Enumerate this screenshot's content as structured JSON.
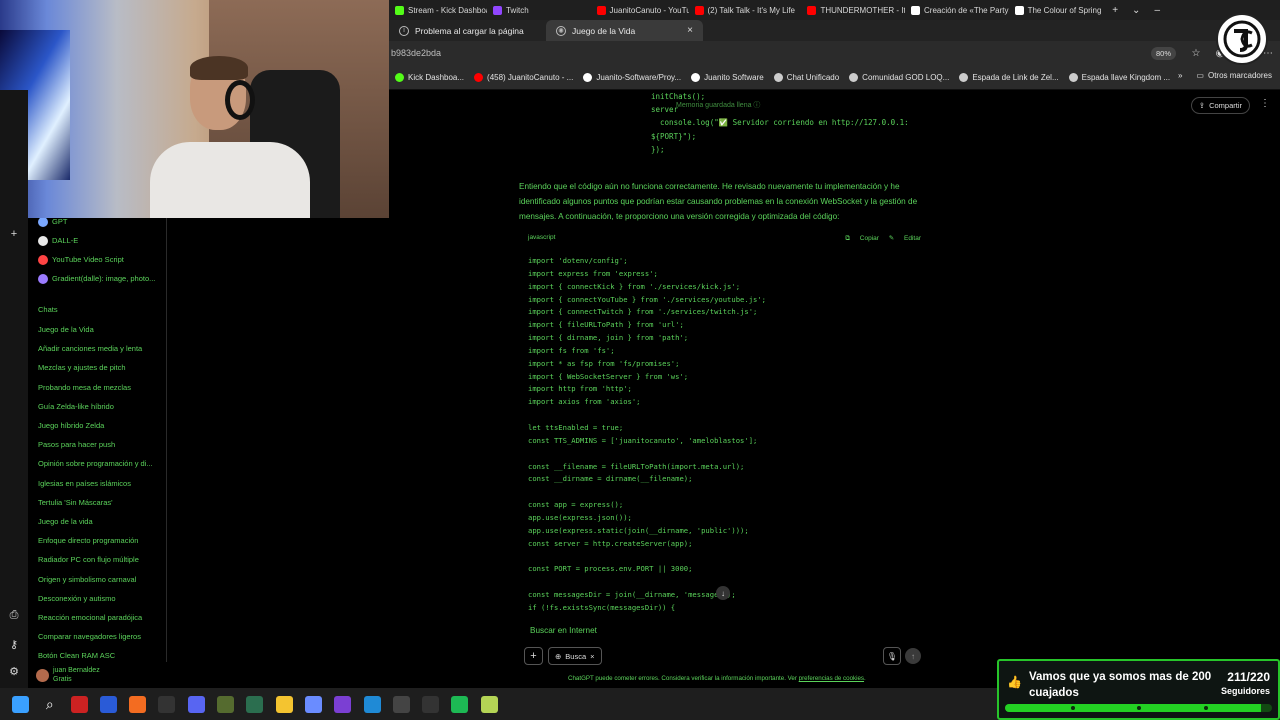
{
  "browser": {
    "tabs": [
      {
        "label": "Stream - Kick Dashboard",
        "color": "#53fc18"
      },
      {
        "label": "Twitch",
        "color": "#9146ff"
      },
      {
        "label": "JuanitoCanuto - YouTube",
        "color": "#ff0000"
      },
      {
        "label": "(2) Talk Talk - It's My Life",
        "color": "#ff0000"
      },
      {
        "label": "THUNDERMOTHER - It",
        "color": "#ff0000"
      },
      {
        "label": "Creación de «The Party»",
        "color": "#ffffff"
      },
      {
        "label": "The Colour of Spring",
        "color": "#ffffff"
      }
    ],
    "row2_tabs": [
      {
        "label": "Problema al cargar la página"
      },
      {
        "label": "Juego de la Vida"
      }
    ],
    "url": "b983de2bda",
    "zoom": "80%",
    "bookmarks": [
      {
        "label": "Kick Dashboa...",
        "color": "#53fc18"
      },
      {
        "label": "(458) JuanitoCanuto - ...",
        "color": "#ff0000"
      },
      {
        "label": "Juanito-Software/Proy...",
        "color": "#ffffff"
      },
      {
        "label": "Juanito Software",
        "color": "#ffffff"
      },
      {
        "label": "Chat Unificado",
        "color": "#cccccc"
      },
      {
        "label": "Comunidad GOD LOQ...",
        "color": "#cccccc"
      },
      {
        "label": "Espada de Link de Zel...",
        "color": "#cccccc"
      },
      {
        "label": "Espada llave Kingdom ...",
        "color": "#cccccc"
      }
    ],
    "other_bookmarks": "Otros marcadores"
  },
  "sidebar": {
    "gpts": [
      {
        "label": "GPT",
        "color": "#7aa7ff"
      },
      {
        "label": "DALL-E",
        "color": "#e8e8e8"
      },
      {
        "label": "YouTube Video Script",
        "color": "#ff4444"
      },
      {
        "label": "Gradient(dalle): image, photo...",
        "color": "#9b7bff"
      }
    ],
    "chats_heading": "Chats",
    "chats": [
      "Juego de la Vida",
      "Añadir canciones media y lenta",
      "Mezclas y ajustes de pitch",
      "Probando mesa de mezclas",
      "Guía Zelda-like híbrido",
      "Juego híbrido Zelda",
      "Pasos para hacer push",
      "Opinión sobre programación y di...",
      "Iglesias en países islámicos",
      "Tertulia 'Sin Máscaras'",
      "Juego de la vida",
      "Enfoque directo programación",
      "Radiador PC con flujo múltiple",
      "Origen y simbolismo carnaval",
      "Desconexión y autismo",
      "Reacción emocional paradójica",
      "Comparar navegadores ligeros",
      "Botón Clean RAM ASC"
    ],
    "user": {
      "name": "juan Bernaldez",
      "plan": "Gratis"
    }
  },
  "main": {
    "code_top": "initChats();\nserver\n  console.log(\"✅ Servidor corriendo en http://127.0.0.1:\n${PORT}\");\n});",
    "memory_note": "Memoria guardada llena ⓘ",
    "share_label": "Compartir",
    "paragraph": "Entiendo que el código aún no funciona correctamente. He revisado nuevamente tu implementación y he identificado algunos puntos que podrían estar causando problemas en la conexión WebSocket y la gestión de mensajes. A continuación, te proporciono una versión corregida y optimizada del código:",
    "code_lang": "javascript",
    "copy_label": "Copiar",
    "edit_label": "Editar",
    "code": "import 'dotenv/config';\nimport express from 'express';\nimport { connectKick } from './services/kick.js';\nimport { connectYouTube } from './services/youtube.js';\nimport { connectTwitch } from './services/twitch.js';\nimport { fileURLToPath } from 'url';\nimport { dirname, join } from 'path';\nimport fs from 'fs';\nimport * as fsp from 'fs/promises';\nimport { WebSocketServer } from 'ws';\nimport http from 'http';\nimport axios from 'axios';\n\nlet ttsEnabled = true;\nconst TTS_ADMINS = ['juanitocanuto', 'ameloblastos'];\n\nconst __filename = fileURLToPath(import.meta.url);\nconst __dirname = dirname(__filename);\n\nconst app = express();\napp.use(express.json());\napp.use(express.static(join(__dirname, 'public')));\nconst server = http.createServer(app);\n\nconst PORT = process.env.PORT || 3000;\n\nconst messagesDir = join(__dirname, 'messages');\nif (!fs.existsSync(messagesDir)) {",
    "search_web": "Buscar en Internet",
    "search_chip": "Busca",
    "disclaimer": "ChatGPT puede cometer errores. Considera verificar la información importante. Ver",
    "disclaimer_link": "preferencias de cookies",
    "disclaimer_end": "."
  },
  "widget": {
    "text": "Vamos que ya somos mas de 200 cuajados",
    "count": "211/220",
    "label": "Seguidores",
    "progress_fraction": 0.959
  },
  "taskbar": {
    "icons": [
      {
        "name": "windows-start-icon",
        "color": "#3aa0ff"
      },
      {
        "name": "search-icon",
        "color": "#1e1e1e"
      },
      {
        "name": "app-icon",
        "color": "#c22"
      },
      {
        "name": "app-icon",
        "color": "#2a5bd7"
      },
      {
        "name": "brave-icon",
        "color": "#f36c21"
      },
      {
        "name": "app-icon",
        "color": "#333"
      },
      {
        "name": "discord-icon",
        "color": "#5865f2"
      },
      {
        "name": "app-icon",
        "color": "#556b2f"
      },
      {
        "name": "chatgpt-icon",
        "color": "#2b6e4f"
      },
      {
        "name": "folder-icon",
        "color": "#f4c430"
      },
      {
        "name": "app-icon",
        "color": "#6a8cff"
      },
      {
        "name": "visual-studio-icon",
        "color": "#7b3fd3"
      },
      {
        "name": "vscode-icon",
        "color": "#1f8ad6"
      },
      {
        "name": "app-icon",
        "color": "#444"
      },
      {
        "name": "obs-icon",
        "color": "#333"
      },
      {
        "name": "spotify-icon",
        "color": "#1db954"
      },
      {
        "name": "app-icon",
        "color": "#b4d455"
      },
      {
        "name": "app-icon",
        "color": "#1e1e1e"
      },
      {
        "name": "app-icon",
        "color": "#1e1e1e"
      }
    ]
  }
}
